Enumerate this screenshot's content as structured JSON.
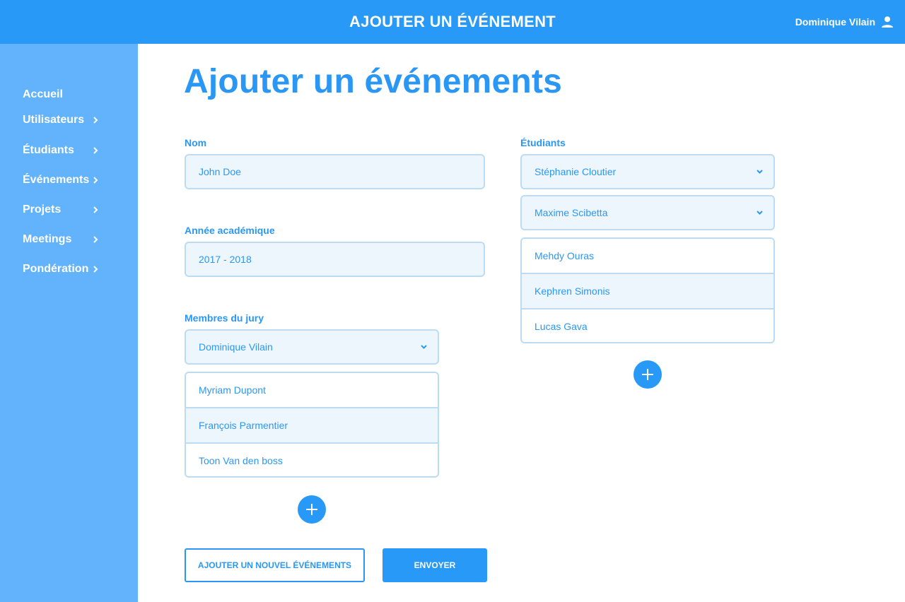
{
  "header": {
    "title": "AJOUTER UN ÉVÉNEMENT",
    "user_name": "Dominique Vilain",
    "user_icon": "user-icon"
  },
  "sidebar": {
    "items": [
      {
        "label": "Accueil",
        "has_chevron": false
      },
      {
        "label": "Utilisateurs",
        "has_chevron": true
      },
      {
        "label": "Étudiants",
        "has_chevron": true
      },
      {
        "label": "Événements",
        "has_chevron": true
      },
      {
        "label": "Projets",
        "has_chevron": true
      },
      {
        "label": "Meetings",
        "has_chevron": true
      },
      {
        "label": "Pondération",
        "has_chevron": true
      }
    ]
  },
  "main": {
    "page_title": "Ajouter un événements",
    "nom": {
      "label": "Nom",
      "value": "John Doe"
    },
    "annee": {
      "label": "Année académique",
      "value": "2017 - 2018"
    },
    "jury": {
      "label": "Membres du jury",
      "selected": "Dominique Vilain",
      "members": [
        "Myriam Dupont",
        "François Parmentier",
        "Toon Van den boss"
      ]
    },
    "etudiants": {
      "label": "Étudiants",
      "selects": [
        "Stéphanie Cloutier",
        "Maxime Scibetta"
      ],
      "members": [
        "Mehdy Ouras",
        "Kephren Simonis",
        "Lucas Gava"
      ]
    },
    "buttons": {
      "add_new": "AJOUTER UN NOUVEL ÉVÉNEMENTS",
      "submit": "ENVOYER"
    }
  },
  "colors": {
    "primary": "#2999f8",
    "sidebar": "#62b3fb",
    "field_bg": "#eef6fd",
    "field_border": "#bcdcf4"
  }
}
